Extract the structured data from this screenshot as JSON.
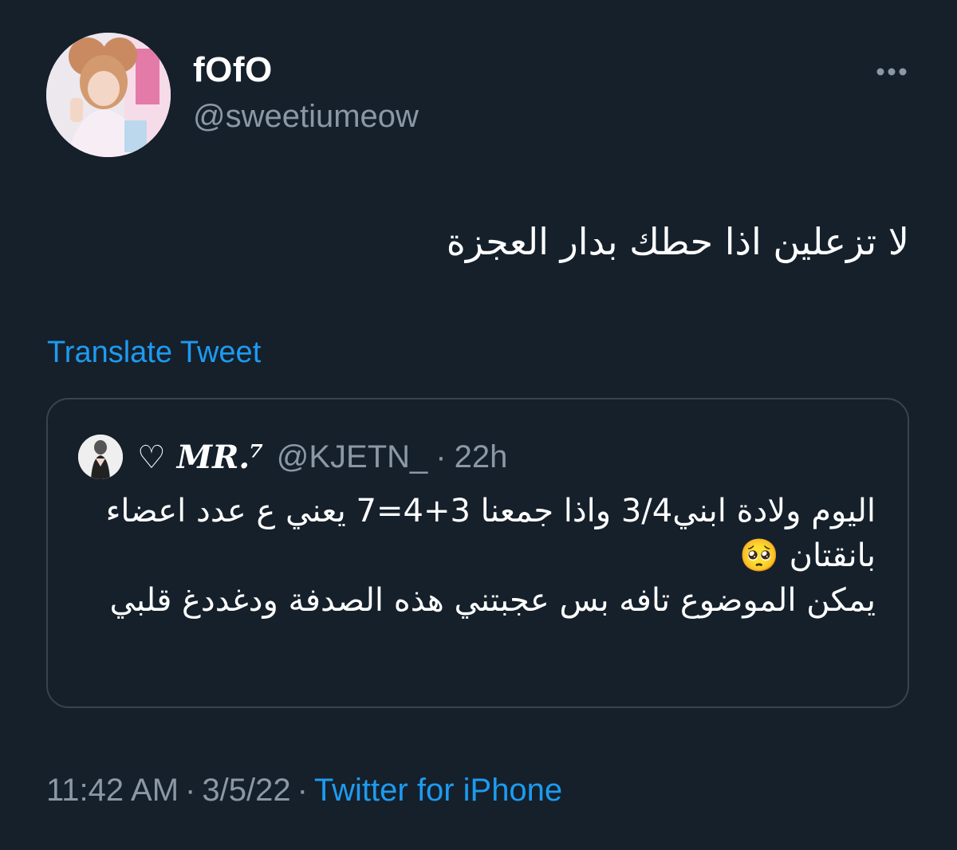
{
  "author": {
    "display_name": "fOfO",
    "handle": "@sweetiumeow",
    "avatar_icon": "profile-photo"
  },
  "tweet": {
    "text": "لا تزعلين اذا حطك بدار العجزة",
    "translate_label": "Translate Tweet"
  },
  "quoted_tweet": {
    "avatar_icon": "profile-photo",
    "display_name": "♡ 𝑴𝑹.⁷",
    "handle": "@KJETN_",
    "separator": "·",
    "time": "22h",
    "text": "اليوم ولادة ابني3/4 واذا جمعنا 3+4=7 يعني ع عدد اعضاء بانقتان 🥺\nيمكن الموضوع تافه بس عجبتني هذه الصدفة ودغددغ قلبي"
  },
  "meta": {
    "time": "11:42 AM",
    "separator": "·",
    "date": "3/5/22",
    "source": "Twitter for iPhone"
  },
  "colors": {
    "background": "#15202b",
    "link": "#1d9bf0",
    "secondary_text": "#8b98a5",
    "border": "#38444d"
  }
}
